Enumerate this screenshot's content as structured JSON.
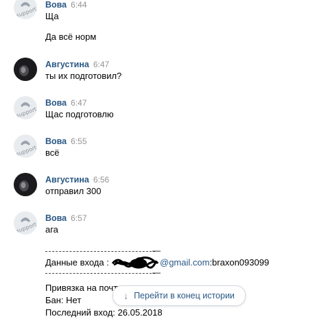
{
  "messages": [
    {
      "author": "Вова",
      "time": "6:44",
      "lines": [
        "Ща",
        "Да всё норм"
      ]
    },
    {
      "author": "Августина",
      "time": "6:47",
      "lines": [
        "ты их подготовил?"
      ]
    },
    {
      "author": "Вова",
      "time": "6:47",
      "lines": [
        "Щас подготовлю"
      ]
    },
    {
      "author": "Вова",
      "time": "6:55",
      "lines": [
        "всё"
      ]
    },
    {
      "author": "Августина",
      "time": "6:56",
      "lines": [
        "отправил 300"
      ]
    },
    {
      "author": "Вова",
      "time": "6:57",
      "lines": [
        "ага"
      ]
    }
  ],
  "avatar_label": "support",
  "details": {
    "login_label": "Данные входа :",
    "email_domain": "@gmail.com",
    "password_part": ":braxon093099",
    "binding_label": "Привязка на почту",
    "ban_label": "Бан: Нет",
    "last_login": "Последний вход: 26.05.2018"
  },
  "jump_button": {
    "label": "Перейти в конец истории",
    "icon": "arrow-down-icon"
  },
  "colors": {
    "author": "#2a5885",
    "time": "#939393",
    "link": "#2a5885"
  }
}
